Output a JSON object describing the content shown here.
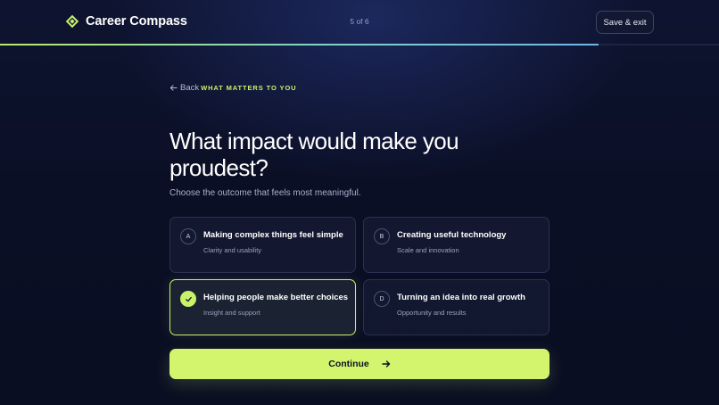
{
  "app": {
    "name": "Career Compass",
    "step_indicator": "5 of 6",
    "save_exit_label": "Save & exit",
    "progress": 0.833,
    "accent_color": "#c8f26a",
    "background_color": "#0b0f24"
  },
  "nav": {
    "back_label": "Back",
    "back_icon": "arrow-left-icon",
    "section_label": "WHAT MATTERS TO YOU"
  },
  "question": {
    "title": "What impact would make you proudest?",
    "subtitle": "Choose the outcome that feels most meaningful."
  },
  "options": [
    {
      "key": "A",
      "title": "Making complex things feel simple",
      "subtitle": "Clarity and usability",
      "selected": false
    },
    {
      "key": "B",
      "title": "Creating useful technology",
      "subtitle": "Scale and innovation",
      "selected": false
    },
    {
      "key": "C",
      "title": "Helping people make better choices",
      "subtitle": "Insight and support",
      "selected": true,
      "icon": "check-icon"
    },
    {
      "key": "D",
      "title": "Turning an idea into real growth",
      "subtitle": "Opportunity and results",
      "selected": false
    }
  ],
  "actions": {
    "continue_label": "Continue",
    "continue_icon": "arrow-right-icon"
  }
}
